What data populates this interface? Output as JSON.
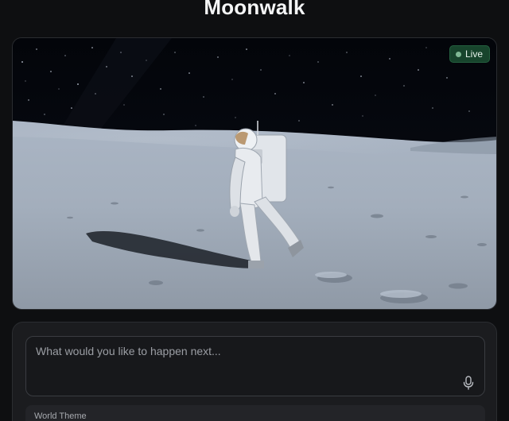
{
  "app": {
    "title": "Moonwalk"
  },
  "video": {
    "status_badge": "Live",
    "status_color": "#7fb894",
    "scene": "astronaut-walking-on-moon"
  },
  "prompt": {
    "value": "",
    "placeholder": "What would you like to happen next...",
    "mic_icon": "microphone-icon"
  },
  "world_theme": {
    "label": "World Theme"
  }
}
